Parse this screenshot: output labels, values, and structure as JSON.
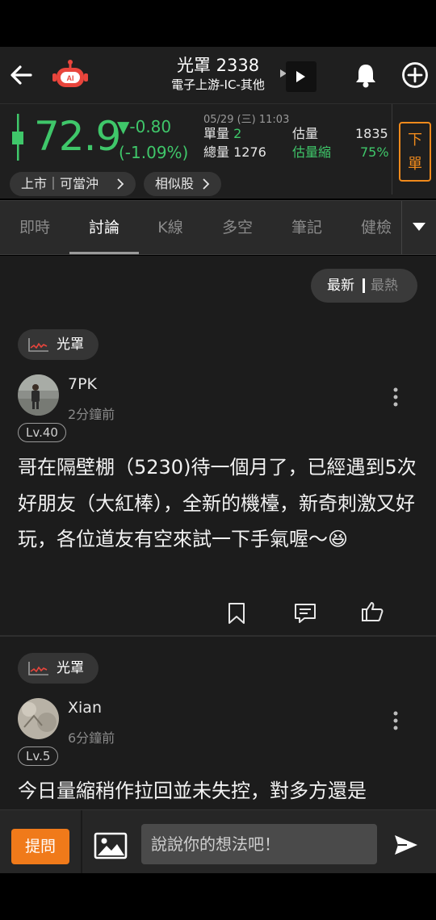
{
  "header": {
    "title": "光罩 2338",
    "subtitle": "電子上游-IC-其他",
    "icons": [
      "back-arrow-icon",
      "ai-robot-icon",
      "play-icon",
      "bell-icon",
      "plus-circle-icon"
    ]
  },
  "quote": {
    "price": "72.9",
    "change": "▼-0.80",
    "change_pct": "(-1.09%)",
    "time": "05/29 (三) 11:03",
    "single_vol_label": "單量",
    "single_vol_value": "2",
    "total_vol_label": "總量",
    "total_vol_value": "1276",
    "est_vol_label": "估量",
    "est_vol_value": "1835",
    "est_shrink_label": "估量縮",
    "est_shrink_value": "75%",
    "order_label_1": "下",
    "order_label_2": "單",
    "market_tag": "上市｜可當沖",
    "similar_tag": "相似股",
    "colors": {
      "down": "#3fc76a",
      "accent": "#f08a1c"
    }
  },
  "tabs": [
    "即時",
    "討論",
    "K線",
    "多空",
    "筆記",
    "健檢"
  ],
  "active_tab": "討論",
  "sort": {
    "newest": "最新",
    "hottest": "最熱"
  },
  "posts": [
    {
      "stock_tag": "光罩",
      "username": "7PK",
      "time": "2分鐘前",
      "level": "Lv.40",
      "content": "哥在隔壁棚（5230)待一個月了，已經遇到5次好朋友（大紅棒），全新的機檯，新奇刺激又好玩，各位道友有空來試一下手氣喔～😆"
    },
    {
      "stock_tag": "光罩",
      "username": "Xian",
      "time": "6分鐘前",
      "level": "Lv.5",
      "content": "今日量縮稍作拉回並未失控，對多方還是"
    }
  ],
  "bottom": {
    "ask_label": "提問",
    "input_placeholder": "說說你的想法吧！"
  }
}
